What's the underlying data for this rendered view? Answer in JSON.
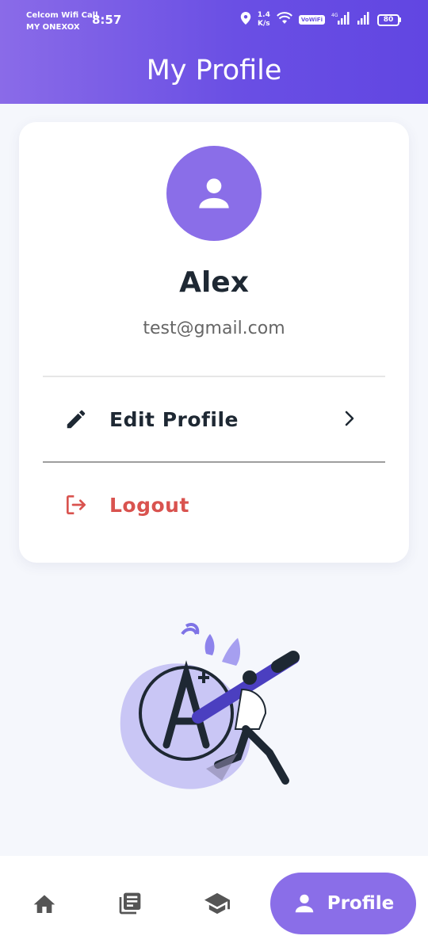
{
  "status_bar": {
    "carrier_line1": "Celcom Wifi Call",
    "carrier_line2": "MY ONEXOX",
    "time": "8:57",
    "speed_value": "1.4",
    "speed_unit": "K/s",
    "vowifi": "VoWiFi",
    "battery": "80"
  },
  "header": {
    "title": "My Profile"
  },
  "profile": {
    "name": "Alex",
    "email": "test@gmail.com"
  },
  "menu": {
    "edit_label": "Edit Profile",
    "logout_label": "Logout"
  },
  "bottom_nav": {
    "profile_label": "Profile",
    "active": "profile"
  },
  "colors": {
    "accent": "#8a6ee8",
    "header_start": "#8a6be8",
    "header_end": "#6146e2",
    "danger": "#d9534f",
    "text_dark": "#1e2833"
  }
}
